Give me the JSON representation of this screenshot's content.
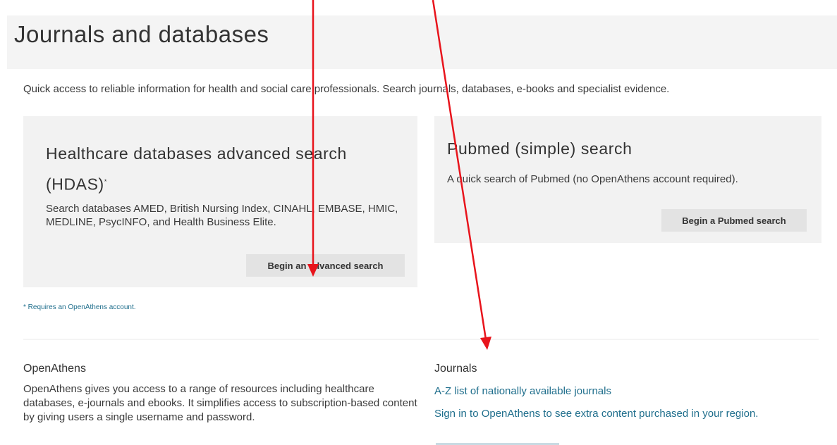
{
  "header": {
    "title": "Journals and databases"
  },
  "intro": "Quick access to reliable information for health and social care professionals. Search journals, databases, e-books and specialist evidence.",
  "hdas": {
    "title": "Healthcare databases advanced search (HDAS)",
    "title_marker": "*",
    "description": "Search databases AMED, British Nursing Index, CINAHL, EMBASE, HMIC, MEDLINE, PsycINFO, and Health Business Elite.",
    "button_label": "Begin an advanced search"
  },
  "pubmed": {
    "title": "Pubmed (simple) search",
    "description": "A quick search of Pubmed (no OpenAthens account required).",
    "button_label": "Begin a Pubmed search"
  },
  "footnote": "* Requires an OpenAthens account.",
  "openathens": {
    "title": "OpenAthens",
    "description": "OpenAthens gives you access to a range of resources including healthcare databases, e-journals and ebooks. It simplifies access to subscription-based content by giving users a single username and password."
  },
  "journals": {
    "title": "Journals",
    "links": [
      "A-Z list of nationally available journals",
      "Sign in to OpenAthens to see extra content purchased in your region."
    ]
  },
  "colors": {
    "annotation_arrow": "#e8141c",
    "link": "#1f6e8c",
    "panel_bg": "#f2f2f2",
    "button_bg": "#e3e3e3"
  }
}
